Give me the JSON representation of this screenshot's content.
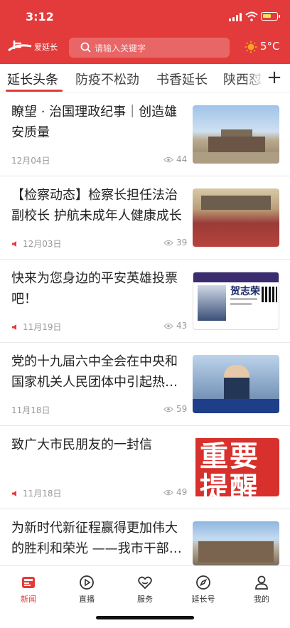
{
  "status": {
    "time": "3:12"
  },
  "header": {
    "logo_text": "爱延长",
    "search_placeholder": "请输入关键字",
    "temperature": "5°C"
  },
  "tabs": [
    {
      "label": "延长头条",
      "active": true
    },
    {
      "label": "防疫不松劲",
      "active": false
    },
    {
      "label": "书香延长",
      "active": false
    },
    {
      "label": "陕西怼",
      "active": false
    }
  ],
  "news": [
    {
      "title": "瞭望 · 治国理政纪事｜创造雄安质量",
      "date": "12月04日",
      "views": "44",
      "audio": false
    },
    {
      "title": "【检察动态】检察长担任法治副校长 护航未成年人健康成长",
      "date": "12月03日",
      "views": "39",
      "audio": true
    },
    {
      "title": "快来为您身边的平安英雄投票吧！",
      "date": "11月19日",
      "views": "43",
      "audio": true,
      "thumb_name": "贺志荣"
    },
    {
      "title": "党的十九届六中全会在中央和国家机关人民团体中引起热…",
      "date": "11月18日",
      "views": "59",
      "audio": false
    },
    {
      "title": "致广大市民朋友的一封信",
      "date": "11月18日",
      "views": "49",
      "audio": true,
      "thumb_text": "重要提醒"
    },
    {
      "title": "为新时代新征程赢得更加伟大的胜利和荣光 ——我市干部…",
      "audio": false
    }
  ],
  "bottom_nav": [
    {
      "label": "新闻",
      "icon": "news-icon",
      "active": true
    },
    {
      "label": "直播",
      "icon": "play-icon",
      "active": false
    },
    {
      "label": "服务",
      "icon": "heart-service-icon",
      "active": false
    },
    {
      "label": "延长号",
      "icon": "compass-icon",
      "active": false
    },
    {
      "label": "我的",
      "icon": "user-icon",
      "active": false
    }
  ],
  "colors": {
    "brand_red": "#e33b3b",
    "weather_sun": "#f5a623"
  }
}
